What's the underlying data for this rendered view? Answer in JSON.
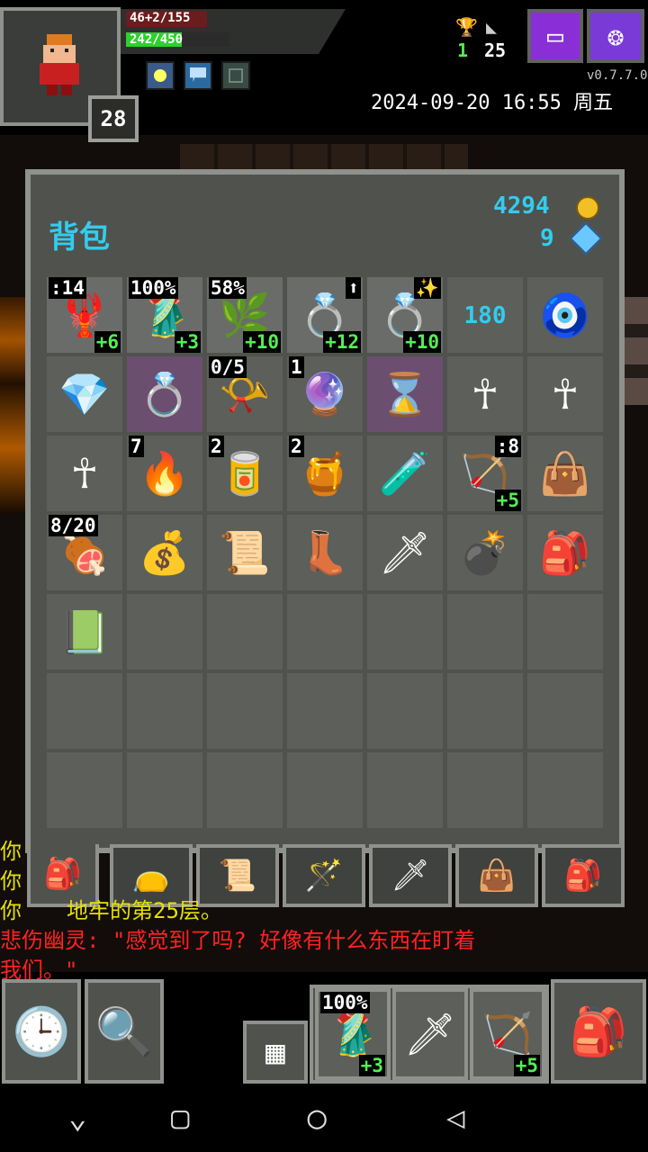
{
  "hero": {
    "hp": "46+2/155",
    "xp": "242/450",
    "xp_fraction": 0.54,
    "hp_fraction": 0.3,
    "level": "28"
  },
  "stats": {
    "trophy": "1",
    "depth": "25"
  },
  "version": "v0.7.7.0",
  "datetime": "2024-09-20 16:55 周五",
  "inventory": {
    "title": "背包",
    "gold": "4294",
    "gems": "9",
    "items": [
      {
        "icon": "🦞",
        "tl": ":14",
        "br": "+6",
        "hl": false
      },
      {
        "icon": "🥻",
        "tl": "100%",
        "br": "+3",
        "hl": false
      },
      {
        "icon": "🌿",
        "tl": "58%",
        "br": "+10",
        "hl": false
      },
      {
        "icon": "💍",
        "tr": "⬆",
        "br": "+12",
        "hl": false
      },
      {
        "icon": "💍",
        "tr": "✨",
        "br": "+10",
        "hl": false
      },
      {
        "icon": "",
        "mid": "180",
        "hl": false
      },
      {
        "icon": "🧿",
        "hl": false
      },
      {
        "icon": "💎",
        "hl": false
      },
      {
        "icon": "💍",
        "hl": true
      },
      {
        "icon": "📯",
        "tl": "0/5",
        "hl": false
      },
      {
        "icon": "🔮",
        "tl": "1",
        "hl": false
      },
      {
        "icon": "⌛",
        "hl": true
      },
      {
        "icon": "☥",
        "hl": false
      },
      {
        "icon": "☥",
        "hl": false
      },
      {
        "icon": "☥",
        "hl": false
      },
      {
        "icon": "🔥",
        "tl": "7",
        "hl": false
      },
      {
        "icon": "🥫",
        "tl": "2",
        "hl": false
      },
      {
        "icon": "🍯",
        "tl": "2",
        "hl": false
      },
      {
        "icon": "🧪",
        "hl": false
      },
      {
        "icon": "🏹",
        "tr": ":8",
        "br": "+5",
        "hl": false
      },
      {
        "icon": "👜",
        "hl": false
      },
      {
        "icon": "🍖",
        "tl": "8/20",
        "hl": false
      },
      {
        "icon": "💰",
        "hl": false
      },
      {
        "icon": "📜",
        "hl": false
      },
      {
        "icon": "👢",
        "hl": false
      },
      {
        "icon": "🗡",
        "hl": false
      },
      {
        "icon": "💣",
        "hl": false
      },
      {
        "icon": "🎒",
        "hl": false
      },
      {
        "icon": "📗",
        "hl": false
      }
    ]
  },
  "log": {
    "line1": "你",
    "line2": "你",
    "line3_prefix": "你",
    "line3_rest": "地牢的第25层。",
    "line4": "悲伤幽灵: \"感觉到了吗? 好像有什么东西在盯着",
    "line5": "我们。\""
  },
  "quickslots": [
    {
      "icon": "🥻",
      "tl": "100%",
      "br": "+3"
    },
    {
      "icon": "🗡",
      "br": ""
    },
    {
      "icon": "🏹",
      "br": "+5"
    }
  ]
}
